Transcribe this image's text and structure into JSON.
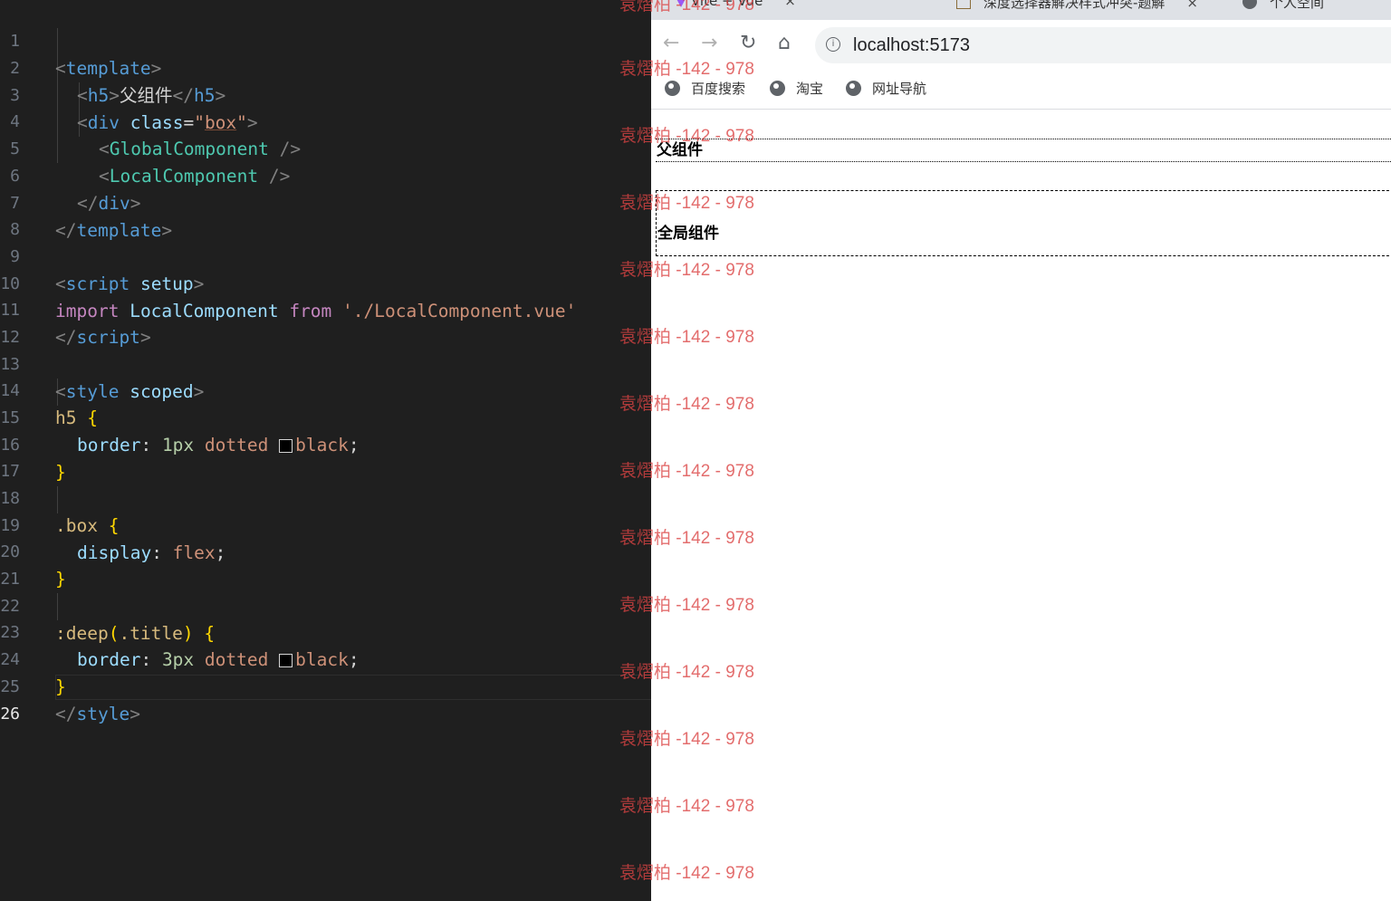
{
  "editor": {
    "line_numbers": [
      "1",
      "2",
      "3",
      "4",
      "5",
      "6",
      "7",
      "8",
      "9",
      "10",
      "11",
      "12",
      "13",
      "14",
      "15",
      "16",
      "17",
      "18",
      "19",
      "20",
      "21",
      "22",
      "23",
      "24",
      "25",
      "26"
    ],
    "active_line": "26",
    "code": {
      "l1_lt": "<",
      "l1_tag": "template",
      "l1_gt": ">",
      "l2_lt": "<",
      "l2_tag": "h5",
      "l2_gt": ">",
      "l2_text": "父组件",
      "l2_close_lt": "</",
      "l2_close_tag": "h5",
      "l2_close_gt": ">",
      "l3_lt": "<",
      "l3_tag": "div",
      "l3_attr": "class",
      "l3_eq": "=",
      "l3_q1": "\"",
      "l3_val": "box",
      "l3_q2": "\"",
      "l3_gt": ">",
      "l4_lt": "<",
      "l4_comp": "GlobalComponent",
      "l4_end": " />",
      "l5_lt": "<",
      "l5_comp": "LocalComponent",
      "l5_end": " />",
      "l6_lt": "</",
      "l6_tag": "div",
      "l6_gt": ">",
      "l7_lt": "</",
      "l7_tag": "template",
      "l7_gt": ">",
      "l9_lt": "<",
      "l9_tag": "script",
      "l9_attr": "setup",
      "l9_gt": ">",
      "l10_kw1": "import",
      "l10_name": "LocalComponent",
      "l10_kw2": "from",
      "l10_str": "'./LocalComponent.vue'",
      "l11_lt": "</",
      "l11_tag": "script",
      "l11_gt": ">",
      "l13_lt": "<",
      "l13_tag": "style",
      "l13_attr": "scoped",
      "l13_gt": ">",
      "l14_sel": "h5",
      "l14_brace": "{",
      "l15_prop": "border",
      "l15_colon": ": ",
      "l15_num": "1px",
      "l15_val": "dotted",
      "l15_color": "black",
      "l15_semi": ";",
      "l16_brace": "}",
      "l18_sel": ".box",
      "l18_brace": "{",
      "l19_prop": "display",
      "l19_colon": ": ",
      "l19_val": "flex",
      "l19_semi": ";",
      "l20_brace": "}",
      "l22_sel1": ":deep",
      "l22_paren1": "(",
      "l22_sel2": ".title",
      "l22_paren2": ")",
      "l22_brace": "{",
      "l23_prop": "border",
      "l23_colon": ": ",
      "l23_num": "3px",
      "l23_val": "dotted",
      "l23_color": "black",
      "l23_semi": ";",
      "l24_brace": "}",
      "l25_lt": "</",
      "l25_tag": "style",
      "l25_gt": ">"
    }
  },
  "browser": {
    "tabs": [
      {
        "label": "Vite + Vue",
        "close": "×"
      },
      {
        "label": "深度选择器解决样式冲突-题解",
        "close": "×"
      },
      {
        "label": "个人空间",
        "close": ""
      }
    ],
    "nav": {
      "back": "←",
      "forward": "→",
      "reload": "↻",
      "home": "⌂"
    },
    "url": "localhost:5173",
    "bookmarks": [
      "百度搜索",
      "淘宝",
      "网址导航"
    ],
    "page": {
      "h5_text": "父组件",
      "global_component_title": "全局组件"
    }
  },
  "watermark": "袁熠柏 -142 - 978",
  "colors": {
    "editor_bg": "#1f1f1f",
    "tag": "#569cd6",
    "component": "#4ec9b0",
    "string": "#ce9178",
    "keyword": "#c586c0",
    "watermark": "#db4444"
  }
}
